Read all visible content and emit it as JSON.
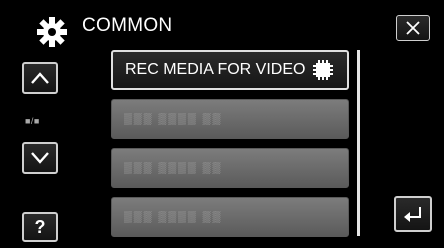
{
  "header": {
    "title": "COMMON",
    "icon": "gear-icon"
  },
  "controls": {
    "close_icon": "close-icon",
    "up_icon": "chevron-up-icon",
    "down_icon": "chevron-down-icon",
    "help_label": "?",
    "back_icon": "return-icon",
    "page_indicator": "■/■"
  },
  "menu": {
    "items": [
      {
        "label": "REC MEDIA FOR VIDEO",
        "icon": "memory-card-icon",
        "selected": true
      },
      {
        "label": "▒▒▒ ▒▒▒▒ ▒▒",
        "selected": false
      },
      {
        "label": "▒▒▒ ▒▒▒▒ ▒▒",
        "selected": false
      },
      {
        "label": "▒▒▒ ▒▒▒▒ ▒▒",
        "selected": false
      }
    ]
  },
  "scrollbar": {
    "position": 0.0,
    "visible_fraction": 1.0
  },
  "colors": {
    "background": "#000000",
    "accent": "#ffffff",
    "item_inactive": "#6b6b6b"
  }
}
